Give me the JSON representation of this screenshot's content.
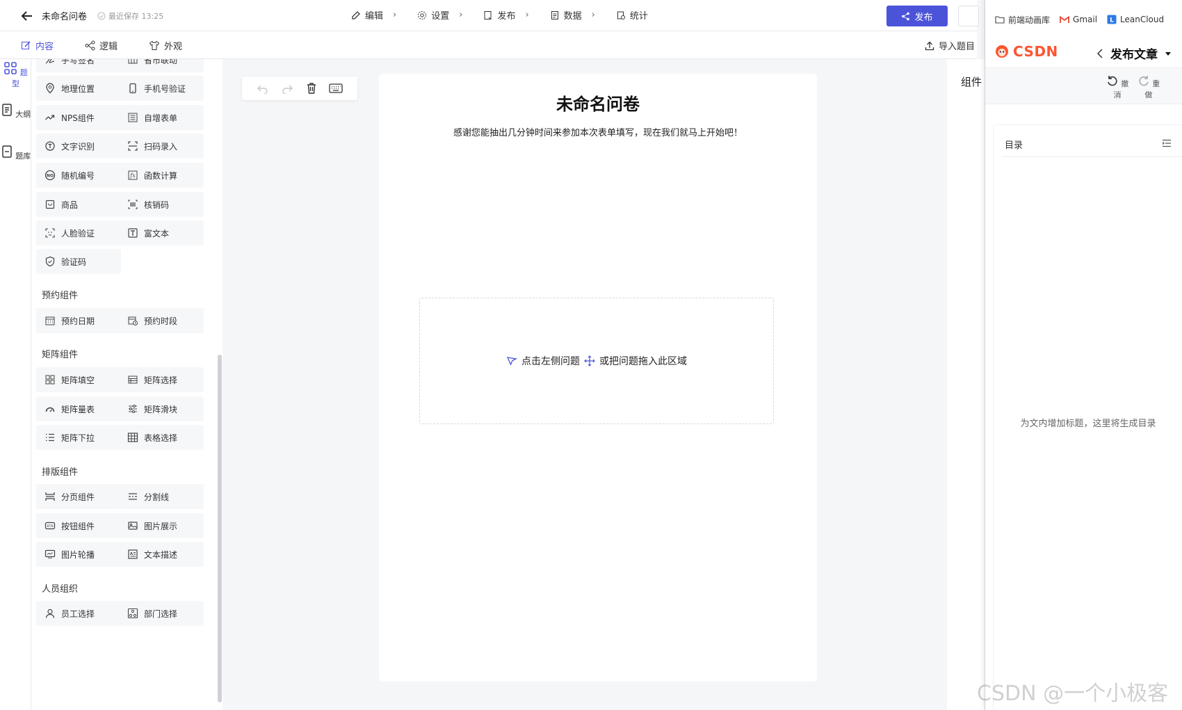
{
  "topbar": {
    "title": "未命名问卷",
    "save_status": "最近保存 13:25",
    "steps": [
      {
        "label": "编辑",
        "icon": "edit-icon"
      },
      {
        "label": "设置",
        "icon": "gear-icon"
      },
      {
        "label": "发布",
        "icon": "publish-icon"
      },
      {
        "label": "数据",
        "icon": "data-icon"
      },
      {
        "label": "统计",
        "icon": "stats-icon"
      }
    ],
    "publish_label": "发布"
  },
  "subbar": {
    "tabs": [
      {
        "label": "内容",
        "active": true
      },
      {
        "label": "逻辑",
        "active": false
      },
      {
        "label": "外观",
        "active": false
      }
    ],
    "import_label": "导入题目"
  },
  "rail": {
    "items": [
      {
        "label": "题型",
        "active": true
      },
      {
        "label": "大纲",
        "active": false
      },
      {
        "label": "题库",
        "active": false
      }
    ]
  },
  "panel": {
    "partial_items": [
      "手写签名",
      "省市联动"
    ],
    "groups": [
      {
        "title": "",
        "items": [
          "地理位置",
          "手机号验证",
          "NPS组件",
          "自增表单",
          "文字识别",
          "扫码录入",
          "随机编号",
          "函数计算",
          "商品",
          "核销码",
          "人脸验证",
          "富文本",
          "验证码"
        ]
      },
      {
        "title": "预约组件",
        "items": [
          "预约日期",
          "预约时段"
        ]
      },
      {
        "title": "矩阵组件",
        "items": [
          "矩阵填空",
          "矩阵选择",
          "矩阵量表",
          "矩阵滑块",
          "矩阵下拉",
          "表格选择"
        ]
      },
      {
        "title": "排版组件",
        "items": [
          "分页组件",
          "分割线",
          "按钮组件",
          "图片展示",
          "图片轮播",
          "文本描述"
        ]
      },
      {
        "title": "人员组织",
        "items": [
          "员工选择",
          "部门选择"
        ]
      }
    ]
  },
  "form": {
    "title": "未命名问卷",
    "description": "感谢您能抽出几分钟时间来参加本次表单填写，现在我们就马上开始吧！",
    "dropzone_part1": "点击左侧问题",
    "dropzone_part2": "或把问题拖入此区域"
  },
  "settings": {
    "label": "组件"
  },
  "csdn": {
    "bookmarks": [
      "前端动画库",
      "Gmail",
      "LeanCloud"
    ],
    "logo_text": "CSDN",
    "page_title": "发布文章",
    "undo_label": "撤消",
    "redo_label": "重做",
    "toc_title": "目录",
    "toc_empty": "为文内增加标题，这里将生成目录"
  },
  "watermark": "CSDN @一个小极客",
  "colors": {
    "accent": "#4b54d9",
    "csdn": "#fc5531"
  }
}
